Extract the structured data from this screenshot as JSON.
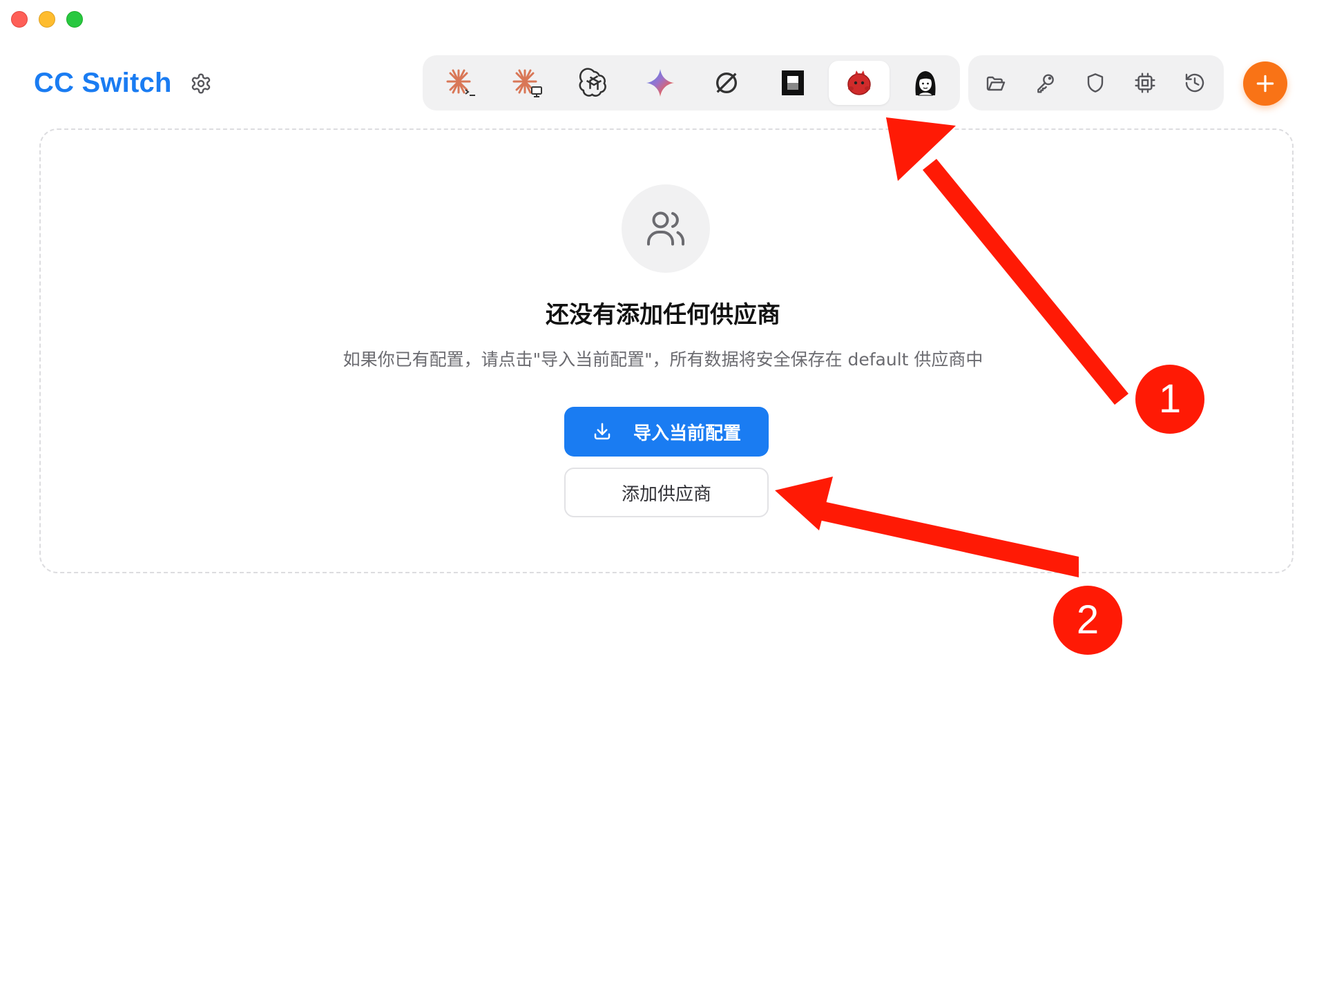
{
  "window": {
    "controls": [
      "close",
      "minimize",
      "maximize"
    ]
  },
  "header": {
    "title": "CC Switch",
    "settings_icon": "gear-icon"
  },
  "app_switcher": {
    "items": [
      {
        "icon": "claude-code-icon",
        "active": false
      },
      {
        "icon": "claude-desktop-icon",
        "active": false
      },
      {
        "icon": "openai-icon",
        "active": false
      },
      {
        "icon": "gemini-icon",
        "active": false
      },
      {
        "icon": "opencode-icon",
        "active": false
      },
      {
        "icon": "terminal-app-icon",
        "active": false
      },
      {
        "icon": "red-mascot-icon",
        "active": true
      },
      {
        "icon": "girl-avatar-icon",
        "active": false
      }
    ]
  },
  "tools": {
    "items": [
      "folder-icon",
      "key-icon",
      "shield-icon",
      "chip-icon",
      "history-icon"
    ]
  },
  "add_button_icon": "plus-icon",
  "empty_state": {
    "icon": "users-icon",
    "title": "还没有添加任何供应商",
    "description": "如果你已有配置，请点击\"导入当前配置\"，所有数据将安全保存在 default 供应商中",
    "import_button_label": "导入当前配置",
    "add_provider_label": "添加供应商"
  },
  "annotations": {
    "badge_1": "1",
    "badge_2": "2",
    "color": "#ff1a05"
  },
  "colors": {
    "accent": "#1a7cf2",
    "fab": "#f97316",
    "panel_border": "#dcdcdf"
  }
}
